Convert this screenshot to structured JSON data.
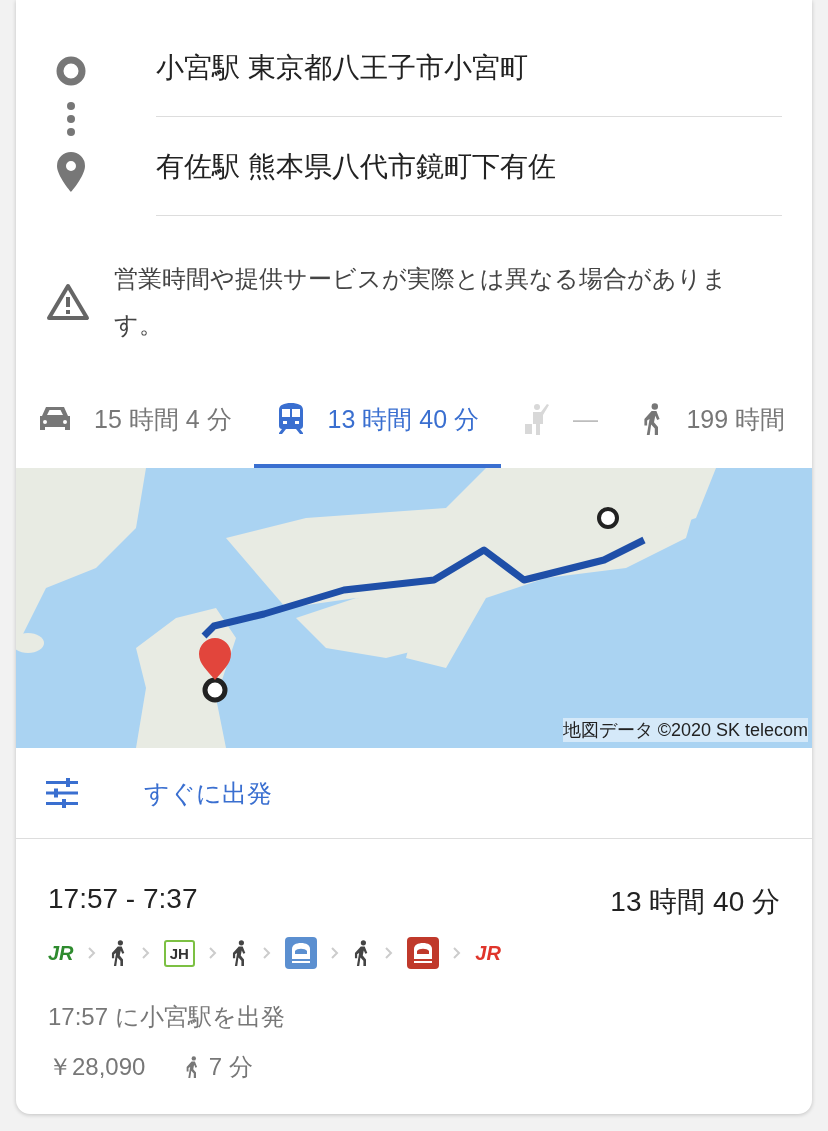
{
  "directions": {
    "origin": {
      "value": "小宮駅 東京都八王子市小宮町"
    },
    "destination": {
      "value": "有佐駅 熊本県八代市鏡町下有佐"
    }
  },
  "notice": {
    "text": "営業時間や提供サービスが実際とは異なる場合があります。"
  },
  "modes": [
    {
      "kind": "car",
      "label": "15 時間 4 分",
      "selected": false,
      "disabled": false
    },
    {
      "kind": "transit",
      "label": "13 時間 40 分",
      "selected": true,
      "disabled": false
    },
    {
      "kind": "ride",
      "label": "—",
      "selected": false,
      "disabled": true
    },
    {
      "kind": "walk",
      "label": "199 時間",
      "selected": false,
      "disabled": false
    }
  ],
  "map": {
    "attribution": "地図データ ©2020 SK telecom"
  },
  "options": {
    "label": "すぐに出発"
  },
  "route": {
    "times": "17:57 - 7:37",
    "duration": "13 時間 40 分",
    "segments": [
      {
        "kind": "logo",
        "label": "JR",
        "color": "#2e8b2e"
      },
      {
        "kind": "walk"
      },
      {
        "kind": "badge",
        "label": "JH",
        "color": "#7cc043"
      },
      {
        "kind": "walk"
      },
      {
        "kind": "train",
        "color": "#5b8fd0"
      },
      {
        "kind": "walk"
      },
      {
        "kind": "train",
        "color": "#c0392b"
      },
      {
        "kind": "logo",
        "label": "JR",
        "color": "#e0352b"
      }
    ],
    "departure": "17:57 に小宮駅を出発",
    "fare": "￥28,090",
    "walk_time": "7 分"
  }
}
